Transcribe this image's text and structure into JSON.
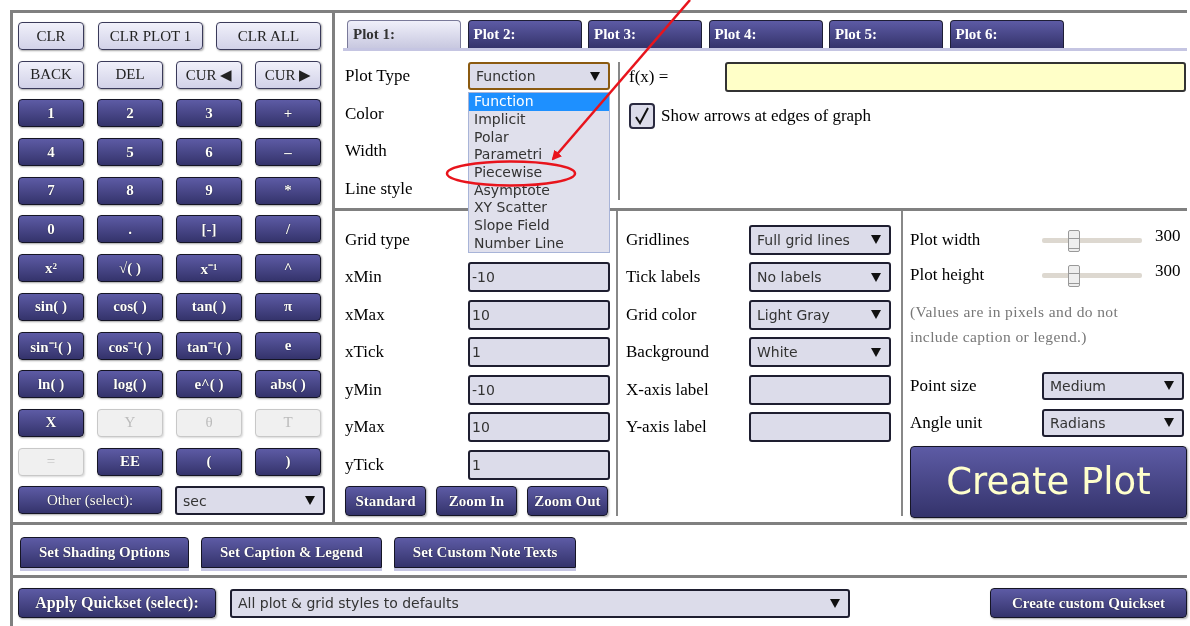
{
  "calculator": {
    "clear_keys": [
      {
        "label": "CLR",
        "kind": "light"
      },
      {
        "label": "CLR PLOT 1",
        "kind": "light"
      },
      {
        "label": "CLR ALL",
        "kind": "light"
      }
    ],
    "rows": [
      [
        {
          "label": "BACK",
          "kind": "light",
          "disabled": false
        },
        {
          "label": "DEL",
          "kind": "light",
          "disabled": false
        },
        {
          "label": "CUR ◀",
          "kind": "light",
          "disabled": false
        },
        {
          "label": "CUR ▶",
          "kind": "light",
          "disabled": false
        }
      ],
      [
        {
          "label": "1",
          "kind": "dark",
          "disabled": false
        },
        {
          "label": "2",
          "kind": "dark",
          "disabled": false
        },
        {
          "label": "3",
          "kind": "dark",
          "disabled": false
        },
        {
          "label": "+",
          "kind": "dark",
          "disabled": false
        }
      ],
      [
        {
          "label": "4",
          "kind": "dark",
          "disabled": false
        },
        {
          "label": "5",
          "kind": "dark",
          "disabled": false
        },
        {
          "label": "6",
          "kind": "dark",
          "disabled": false
        },
        {
          "label": "–",
          "kind": "dark",
          "disabled": false
        }
      ],
      [
        {
          "label": "7",
          "kind": "dark",
          "disabled": false
        },
        {
          "label": "8",
          "kind": "dark",
          "disabled": false
        },
        {
          "label": "9",
          "kind": "dark",
          "disabled": false
        },
        {
          "label": "*",
          "kind": "dark",
          "disabled": false
        }
      ],
      [
        {
          "label": "0",
          "kind": "dark",
          "disabled": false
        },
        {
          "label": ".",
          "kind": "dark",
          "disabled": false
        },
        {
          "label": "[-]",
          "kind": "dark",
          "disabled": false
        },
        {
          "label": "/",
          "kind": "dark",
          "disabled": false
        }
      ],
      [
        {
          "label": "x²",
          "kind": "dark",
          "disabled": false
        },
        {
          "label": "√( )",
          "kind": "dark",
          "disabled": false
        },
        {
          "label": "x⁻¹",
          "kind": "dark",
          "disabled": false
        },
        {
          "label": "^",
          "kind": "dark",
          "disabled": false
        }
      ],
      [
        {
          "label": "sin( )",
          "kind": "dark",
          "disabled": false
        },
        {
          "label": "cos( )",
          "kind": "dark",
          "disabled": false
        },
        {
          "label": "tan( )",
          "kind": "dark",
          "disabled": false
        },
        {
          "label": "π",
          "kind": "dark",
          "disabled": false
        }
      ],
      [
        {
          "label": "sin⁻¹( )",
          "kind": "dark",
          "disabled": false
        },
        {
          "label": "cos⁻¹( )",
          "kind": "dark",
          "disabled": false
        },
        {
          "label": "tan⁻¹( )",
          "kind": "dark",
          "disabled": false
        },
        {
          "label": "e",
          "kind": "dark",
          "disabled": false
        }
      ],
      [
        {
          "label": "ln( )",
          "kind": "dark",
          "disabled": false
        },
        {
          "label": "log( )",
          "kind": "dark",
          "disabled": false
        },
        {
          "label": "e^( )",
          "kind": "dark",
          "disabled": false
        },
        {
          "label": "abs( )",
          "kind": "dark",
          "disabled": false
        }
      ],
      [
        {
          "label": "X",
          "kind": "dark",
          "disabled": false
        },
        {
          "label": "Y",
          "kind": "dark",
          "disabled": true
        },
        {
          "label": "θ",
          "kind": "dark",
          "disabled": true
        },
        {
          "label": "T",
          "kind": "dark",
          "disabled": true
        }
      ],
      [
        {
          "label": "=",
          "kind": "dark",
          "disabled": true
        },
        {
          "label": "EE",
          "kind": "dark",
          "disabled": false
        },
        {
          "label": "(",
          "kind": "dark",
          "disabled": false
        },
        {
          "label": ")",
          "kind": "dark",
          "disabled": false
        }
      ]
    ],
    "other": {
      "label": "Other (select):",
      "value": "sec"
    }
  },
  "plot_tabs": [
    {
      "label": "Plot 1:",
      "selected": true
    },
    {
      "label": "Plot 2:",
      "selected": false
    },
    {
      "label": "Plot 3:",
      "selected": false
    },
    {
      "label": "Plot 4:",
      "selected": false
    },
    {
      "label": "Plot 5:",
      "selected": false
    },
    {
      "label": "Plot 6:",
      "selected": false
    }
  ],
  "plot": {
    "fields": [
      {
        "label": "Plot Type",
        "value": "Function"
      },
      {
        "label": "Color"
      },
      {
        "label": "Width"
      },
      {
        "label": "Line style"
      }
    ],
    "dropdown": [
      {
        "label": "Function",
        "selected": true
      },
      {
        "label": "Implicit",
        "selected": false
      },
      {
        "label": "Polar",
        "selected": false
      },
      {
        "label": "Parametri",
        "selected": false
      },
      {
        "label": "Piecewise",
        "selected": false
      },
      {
        "label": "Asymptote",
        "selected": false
      },
      {
        "label": "XY Scatter",
        "selected": false
      },
      {
        "label": "Slope Field",
        "selected": false
      },
      {
        "label": "Number Line",
        "selected": false
      }
    ],
    "formula_label": "f(x) =",
    "arrows_checkbox": {
      "label": "Show arrows at edges of graph",
      "checked": true
    }
  },
  "grid": {
    "window": [
      {
        "label": "Grid type",
        "kind": "hidden"
      },
      {
        "label": "xMin",
        "kind": "input",
        "value": "-10"
      },
      {
        "label": "xMax",
        "kind": "input",
        "value": "10"
      },
      {
        "label": "xTick",
        "kind": "input",
        "value": "1"
      },
      {
        "label": "yMin",
        "kind": "input",
        "value": "-10"
      },
      {
        "label": "yMax",
        "kind": "input",
        "value": "10"
      },
      {
        "label": "yTick",
        "kind": "input",
        "value": "1"
      }
    ],
    "zoom_buttons": [
      "Standard",
      "Zoom In",
      "Zoom Out"
    ],
    "style": [
      {
        "label": "Gridlines",
        "kind": "select",
        "value": "Full grid lines"
      },
      {
        "label": "Tick labels",
        "kind": "select",
        "value": "No labels"
      },
      {
        "label": "Grid color",
        "kind": "select",
        "value": "Light Gray"
      },
      {
        "label": "Background",
        "kind": "select",
        "value": "White"
      },
      {
        "label": "X-axis label",
        "kind": "input"
      },
      {
        "label": "Y-axis label",
        "kind": "input"
      }
    ],
    "sliders": [
      {
        "label": "Plot width",
        "level": 0.3,
        "reading": "300"
      },
      {
        "label": "Plot height",
        "level": 0.29,
        "reading": "300"
      }
    ],
    "note": "(Values are in pixels and do not include caption or legend.)",
    "selects": [
      {
        "label": "Point size",
        "value": "Medium"
      },
      {
        "label": "Angle unit",
        "value": "Radians"
      }
    ],
    "create_button": "Create Plot"
  },
  "option_tabs": [
    "Set Shading Options",
    "Set Caption & Legend",
    "Set Custom Note Texts"
  ],
  "quickset": {
    "button": "Apply Quickset (select):",
    "value": "All plot & grid styles to defaults",
    "custom_button": "Create custom Quickset"
  }
}
